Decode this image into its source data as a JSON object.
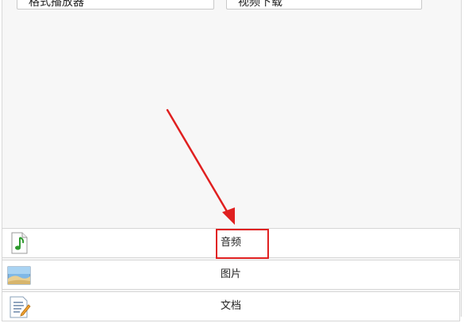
{
  "top_buttons": {
    "left_label": "格式播放器",
    "right_label": "视频下载"
  },
  "list": {
    "items": [
      {
        "label": "音频",
        "icon": "audio-file-icon"
      },
      {
        "label": "图片",
        "icon": "picture-file-icon"
      },
      {
        "label": "文档",
        "icon": "document-file-icon"
      }
    ]
  },
  "annotation": {
    "color": "#e02020",
    "highlighted_item": "音频"
  }
}
